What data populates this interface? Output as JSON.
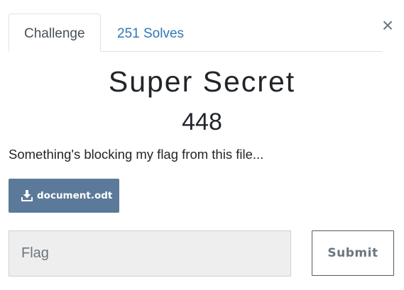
{
  "tabs": [
    {
      "label": "Challenge",
      "active": true
    },
    {
      "label": "251 Solves",
      "active": false
    }
  ],
  "close_symbol": "×",
  "challenge": {
    "name": "Super Secret",
    "points": "448",
    "description": "Something's blocking my flag from this file..."
  },
  "file": {
    "label": "document.odt",
    "icon": "download-icon"
  },
  "flag_input": {
    "placeholder": "Flag",
    "value": ""
  },
  "submit_label": "Submit",
  "colors": {
    "tab_link": "#2e78b7",
    "file_button": "#5b7a99",
    "input_background": "#eeeeee"
  }
}
